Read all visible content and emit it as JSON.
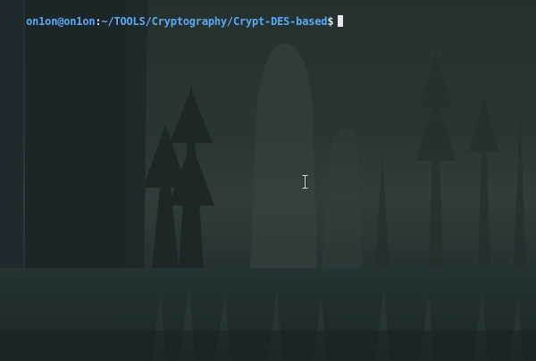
{
  "terminal": {
    "prompt": {
      "user_host": "on1on@on1on",
      "separator": ":",
      "path": "~/TOOLS/Cryptography/Crypt-DES-based",
      "symbol": "$"
    },
    "colors": {
      "background": "#1f2a30",
      "prompt_user_path": "#5aa9f0",
      "prompt_symbol": "#d7dde2",
      "cursor": "#e6e8ea"
    },
    "icons": {
      "cursor": "block-cursor",
      "mouse_pointer": "ibeam-cursor-icon"
    }
  }
}
